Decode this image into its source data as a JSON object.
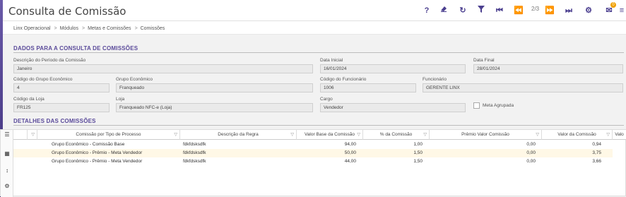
{
  "app": {
    "title": "Consulta de Comissão"
  },
  "toolbar": {
    "help": "?",
    "page_indicator": "2/3",
    "notification_count": "0"
  },
  "breadcrumb": [
    "Linx Operacional",
    "Módulos",
    "Metas e Comissões",
    "Comissões"
  ],
  "form": {
    "section_title": "DADOS PARA A CONSULTA DE COMISSÕES",
    "periodo_label": "Descrição do Período da Comissão",
    "periodo_value": "Janeiro",
    "data_inicial_label": "Data Inicial",
    "data_inicial_value": "16/01/2024",
    "data_final_label": "Data Final",
    "data_final_value": "28/01/2024",
    "cod_grupo_label": "Código do Grupo Econômico",
    "cod_grupo_value": "4",
    "grupo_label": "Grupo Econômico",
    "grupo_value": "Franqueado",
    "cod_func_label": "Código do Funcionário",
    "cod_func_value": "1006",
    "func_label": "Funcionário",
    "func_value": "GERENTE LINX",
    "cod_loja_label": "Código da Loja",
    "cod_loja_value": "FR125",
    "loja_label": "Loja",
    "loja_value": "Franqueado NFC-e (Loja)",
    "cargo_label": "Cargo",
    "cargo_value": "Vendedor",
    "meta_agrupada_label": "Meta Agrupada"
  },
  "details": {
    "section_title": "DETALHES DAS COMISSÕES",
    "columns": [
      "Comissão por Tipo de Processo",
      "Descrição da Regra",
      "Valor Base da Comissão",
      "% da Comissão",
      "Prêmio Valor Comissão",
      "Valor da Comissão",
      "Valo"
    ],
    "rows": [
      [
        "Grupo Econômico - Comissão Base",
        "fdkfdsksdfk",
        "94,00",
        "1,00",
        "0,00",
        "0,94"
      ],
      [
        "Grupo Econômico - Prêmio - Meta Vendedor",
        "fdkfdsksdfk",
        "50,00",
        "1,50",
        "0,00",
        "3,75"
      ],
      [
        "Grupo Econômico - Prêmio - Meta Vendedor",
        "fdkfdsksdfk",
        "44,00",
        "1,50",
        "0,00",
        "3,66"
      ]
    ]
  },
  "colors": {
    "accent": "#5a4a9a",
    "sidebar": "#3d2f7a",
    "selected_row": "#fff8e6"
  }
}
